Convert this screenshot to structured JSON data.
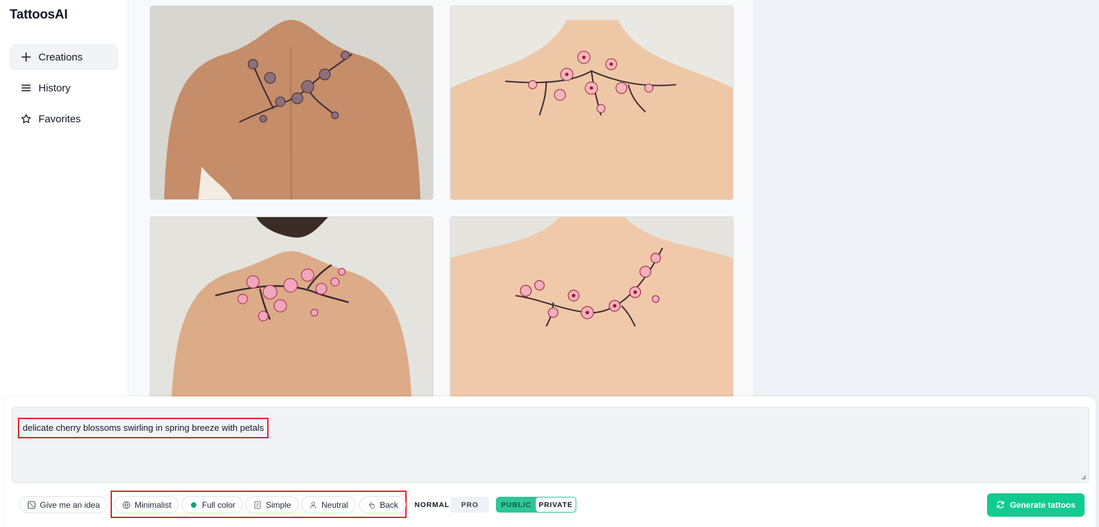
{
  "app": {
    "title": "TattoosAI"
  },
  "sidebar": {
    "items": [
      {
        "label": "Creations",
        "icon": "plus-icon",
        "active": true
      },
      {
        "label": "History",
        "icon": "menu-lines-icon",
        "active": false
      },
      {
        "label": "Favorites",
        "icon": "star-icon",
        "active": false
      }
    ]
  },
  "gallery": {
    "images": [
      {
        "alt": "back tattoo cherry blossom dark ink",
        "tone": "#c08a67"
      },
      {
        "alt": "back tattoo cherry blossom red",
        "tone": "#e9c3a3"
      },
      {
        "alt": "back tattoo cherry blossom pink",
        "tone": "#d9a886"
      },
      {
        "alt": "back tattoo cherry blossom crimson",
        "tone": "#ebc6a7"
      }
    ]
  },
  "prompt": {
    "text": "delicate cherry blossoms swirling in spring breeze with petals"
  },
  "toolbar": {
    "idea_label": "Give me an idea",
    "options": [
      {
        "label": "Minimalist",
        "icon": "globe-icon"
      },
      {
        "label": "Full color",
        "icon": "color-dot-icon"
      },
      {
        "label": "Simple",
        "icon": "document-icon"
      },
      {
        "label": "Neutral",
        "icon": "person-icon"
      },
      {
        "label": "Back",
        "icon": "pointer-icon"
      }
    ],
    "quality": {
      "normal": "NORMAL",
      "pro": "PRO",
      "selected": "NORMAL"
    },
    "visibility": {
      "public": "PUBLIC",
      "private": "PRIVATE",
      "selected": "PRIVATE"
    },
    "generate_label": "Generate tattoos"
  },
  "colors": {
    "accent": "#12cc8f",
    "highlight_border": "#e02424",
    "toggle_green": "#2fc596"
  }
}
